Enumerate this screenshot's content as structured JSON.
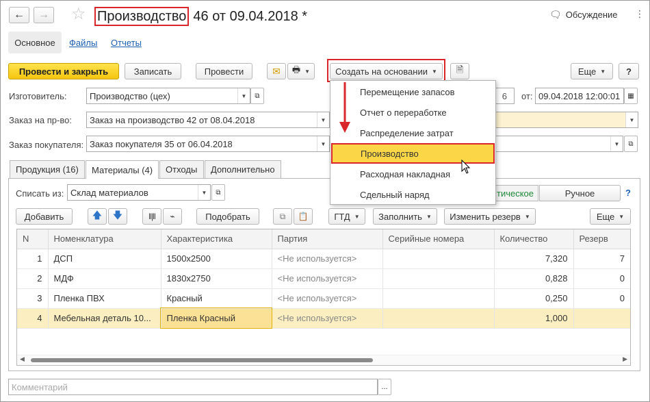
{
  "header": {
    "title_doc": "Производство",
    "title_rest": "46 от 09.04.2018 *",
    "discussion": "Обсуждение"
  },
  "nav_tabs": [
    {
      "label": "Основное"
    },
    {
      "label": "Файлы"
    },
    {
      "label": "Отчеты"
    }
  ],
  "toolbar": {
    "post_close": "Провести и закрыть",
    "save": "Записать",
    "post": "Провести",
    "create_based": "Создать на основании",
    "more": "Еще",
    "help": "?"
  },
  "form": {
    "manufacturer_label": "Изготовитель:",
    "manufacturer_value": "Производство (цех)",
    "order_label": "Заказ на пр-во:",
    "order_value": "Заказ на производство 42 от 08.04.2018",
    "customer_order_label": "Заказ покупателя:",
    "customer_order_value": "Заказ покупателя 35 от 06.04.2018",
    "date_label": "от:",
    "date_value": "09.04.2018 12:00:01",
    "partial_number": "6"
  },
  "content_tabs": [
    {
      "label": "Продукция (16)"
    },
    {
      "label": "Материалы (4)"
    },
    {
      "label": "Отходы"
    },
    {
      "label": "Дополнительно"
    }
  ],
  "materials": {
    "writeoff_label": "Списать из:",
    "writeoff_value": "Склад материалов",
    "mode_auto_partial": "тическое",
    "mode_manual": "Ручное",
    "help": "?",
    "add": "Добавить",
    "pick": "Подобрать",
    "gtd": "ГТД",
    "fill": "Заполнить",
    "change_reserve": "Изменить резерв",
    "more": "Еще"
  },
  "table": {
    "columns": [
      "N",
      "Номенклатура",
      "Характеристика",
      "Партия",
      "Серийные номера",
      "Количество",
      "Резерв"
    ],
    "rows": [
      {
        "n": "1",
        "item": "ДСП",
        "spec": "1500х2500",
        "batch": "<Не используется>",
        "serial": "",
        "qty": "7,320",
        "reserve": "7"
      },
      {
        "n": "2",
        "item": "МДФ",
        "spec": "1830х2750",
        "batch": "<Не используется>",
        "serial": "",
        "qty": "0,828",
        "reserve": "0"
      },
      {
        "n": "3",
        "item": "Пленка ПВХ",
        "spec": "Красный",
        "batch": "<Не используется>",
        "serial": "",
        "qty": "0,250",
        "reserve": "0"
      },
      {
        "n": "4",
        "item": "Мебельная деталь 10...",
        "spec": "Пленка Красный",
        "batch": "<Не используется>",
        "serial": "",
        "qty": "1,000",
        "reserve": ""
      }
    ]
  },
  "comment_placeholder": "Комментарий",
  "comment_btn": "...",
  "dropdown_menu": [
    {
      "label": "Перемещение запасов"
    },
    {
      "label": "Отчет о переработке"
    },
    {
      "label": "Распределение затрат"
    },
    {
      "label": "Производство"
    },
    {
      "label": "Расходная накладная"
    },
    {
      "label": "Сдельный наряд"
    }
  ],
  "colors": {
    "accent_yellow": "#f5c60f",
    "highlight_red": "#d8262b",
    "link_blue": "#1a5fb4"
  }
}
